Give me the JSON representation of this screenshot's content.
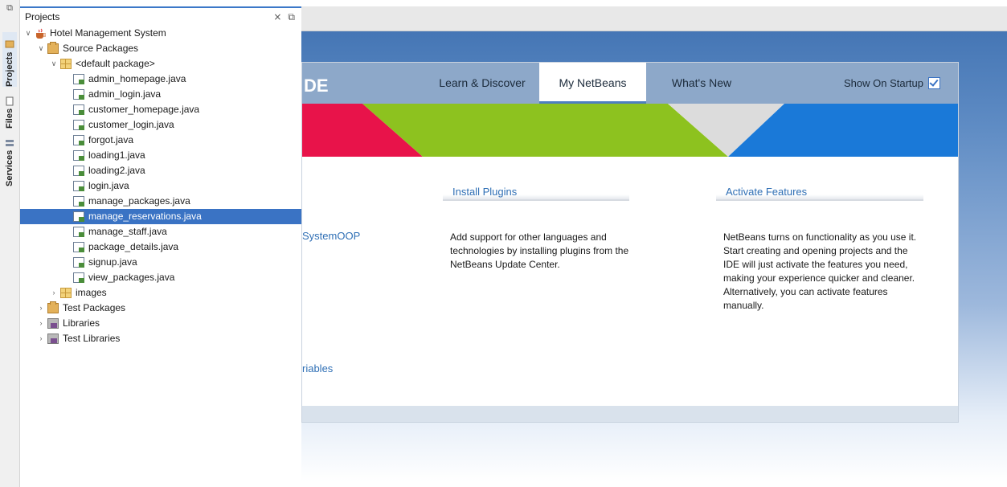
{
  "sidebar": {
    "tabs": [
      {
        "label": "Projects",
        "icon": "projects-icon"
      },
      {
        "label": "Files",
        "icon": "files-icon"
      },
      {
        "label": "Services",
        "icon": "services-icon"
      }
    ]
  },
  "projects_panel": {
    "title": "Projects",
    "close_glyph": "×",
    "restore_glyph": "⧉",
    "tree": {
      "root": "Hotel Management System",
      "source_packages": "Source Packages",
      "default_package": "<default package>",
      "files": [
        "admin_homepage.java",
        "admin_login.java",
        "customer_homepage.java",
        "customer_login.java",
        "forgot.java",
        "loading1.java",
        "loading2.java",
        "login.java",
        "manage_packages.java",
        "manage_reservations.java",
        "manage_staff.java",
        "package_details.java",
        "signup.java",
        "view_packages.java"
      ],
      "selected_file": "manage_reservations.java",
      "images": "images",
      "test_packages": "Test Packages",
      "libraries": "Libraries",
      "test_libraries": "Test Libraries"
    }
  },
  "start_page": {
    "ide_fragment": "DE",
    "tabs": [
      "Learn & Discover",
      "My NetBeans",
      "What's New"
    ],
    "active_tab": "My NetBeans",
    "show_on_startup": "Show On Startup",
    "show_on_startup_checked": true,
    "recent_fragment": "SystemOOP",
    "variables_fragment": "riables",
    "install": {
      "heading": "Install Plugins",
      "text": "Add support for other languages and technologies by installing plugins from the NetBeans Update Center."
    },
    "activate": {
      "heading": "Activate Features",
      "text": "NetBeans turns on functionality as you use it. Start creating and opening projects and the IDE will just activate the features you need, making your experience quicker and cleaner. Alternatively, you can activate features manually."
    }
  },
  "colors": {
    "accent": "#3a73c4",
    "banner_red": "#e8134a",
    "banner_green": "#8dc21f",
    "banner_blue": "#1a79d8",
    "link": "#2f6fb5"
  }
}
